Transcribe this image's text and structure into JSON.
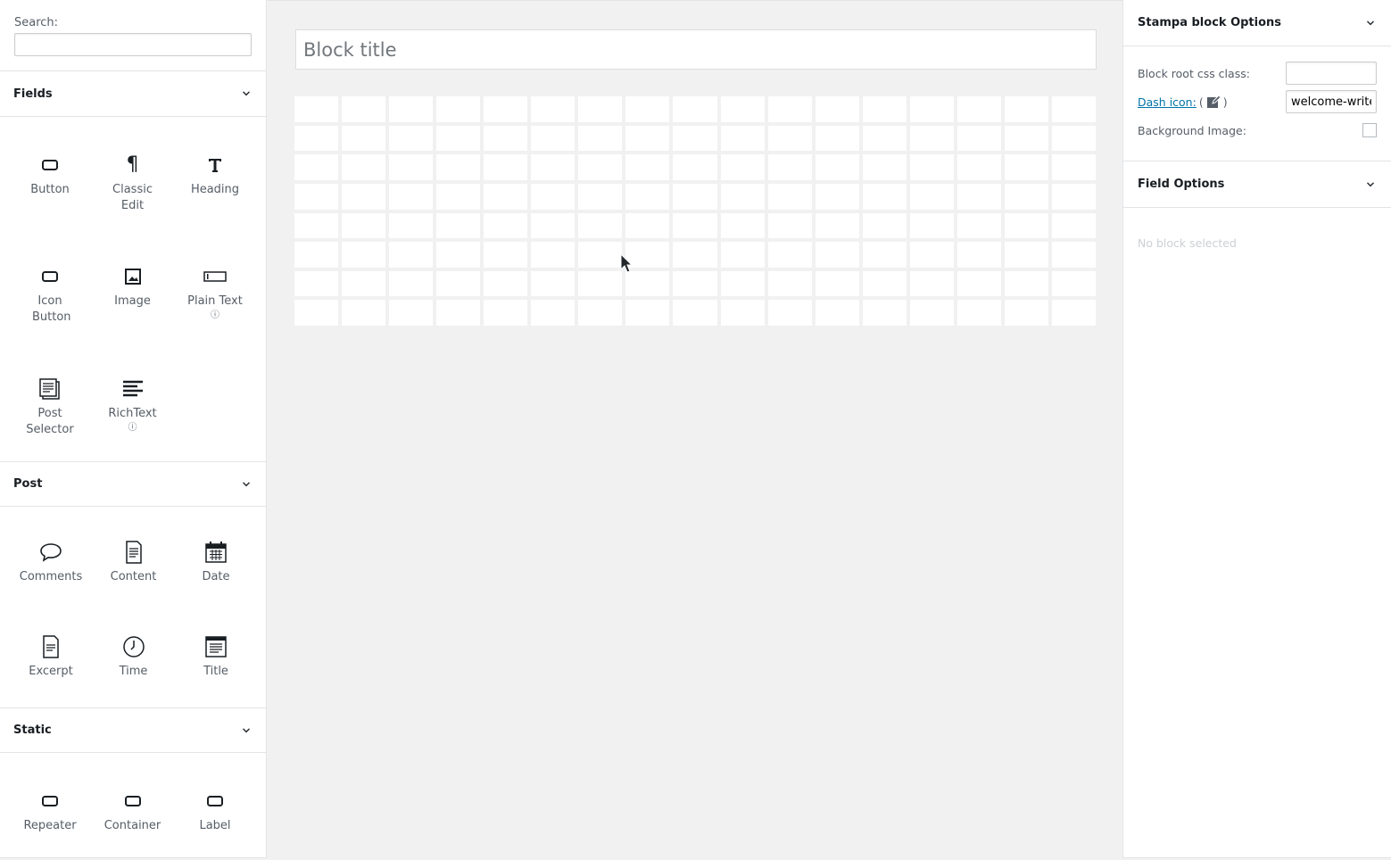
{
  "left_sidebar": {
    "search": {
      "label": "Search:",
      "value": "",
      "placeholder": ""
    },
    "sections": {
      "fields": {
        "title": "Fields",
        "items": [
          {
            "label": "Button",
            "icon": "button-icon"
          },
          {
            "label": "Classic Edit",
            "icon": "paragraph-icon"
          },
          {
            "label": "Heading",
            "icon": "heading-icon"
          },
          {
            "label": "Icon Button",
            "icon": "button-icon"
          },
          {
            "label": "Image",
            "icon": "image-icon"
          },
          {
            "label": "Plain Text",
            "icon": "plaintext-icon",
            "info": "ⓘ"
          },
          {
            "label": "Post Selector",
            "icon": "post-selector-icon"
          },
          {
            "label": "RichText",
            "icon": "richtext-icon",
            "info": "ⓘ"
          }
        ]
      },
      "post": {
        "title": "Post",
        "items": [
          {
            "label": "Comments",
            "icon": "comment-icon"
          },
          {
            "label": "Content",
            "icon": "document-icon"
          },
          {
            "label": "Date",
            "icon": "calendar-icon"
          },
          {
            "label": "Excerpt",
            "icon": "document-icon"
          },
          {
            "label": "Time",
            "icon": "clock-icon"
          },
          {
            "label": "Title",
            "icon": "title-icon"
          }
        ]
      },
      "static": {
        "title": "Static",
        "items": [
          {
            "label": "Repeater",
            "icon": "button-icon"
          },
          {
            "label": "Container",
            "icon": "button-icon"
          },
          {
            "label": "Label",
            "icon": "button-icon"
          }
        ]
      }
    }
  },
  "canvas": {
    "title_placeholder": "Block title"
  },
  "right_sidebar": {
    "block_options": {
      "title": "Stampa block Options",
      "root_css_label": "Block root css class:",
      "root_css_value": "",
      "dash_icon_label": "Dash icon:",
      "dash_icon_open": "(",
      "dash_icon_close": ")",
      "dash_icon_value": "welcome-write-blog",
      "bg_image_label": "Background Image:"
    },
    "field_options": {
      "title": "Field Options",
      "empty_text": "No block selected"
    }
  },
  "colors": {
    "accent_link": "#0073aa",
    "background": "#f1f1f1"
  }
}
